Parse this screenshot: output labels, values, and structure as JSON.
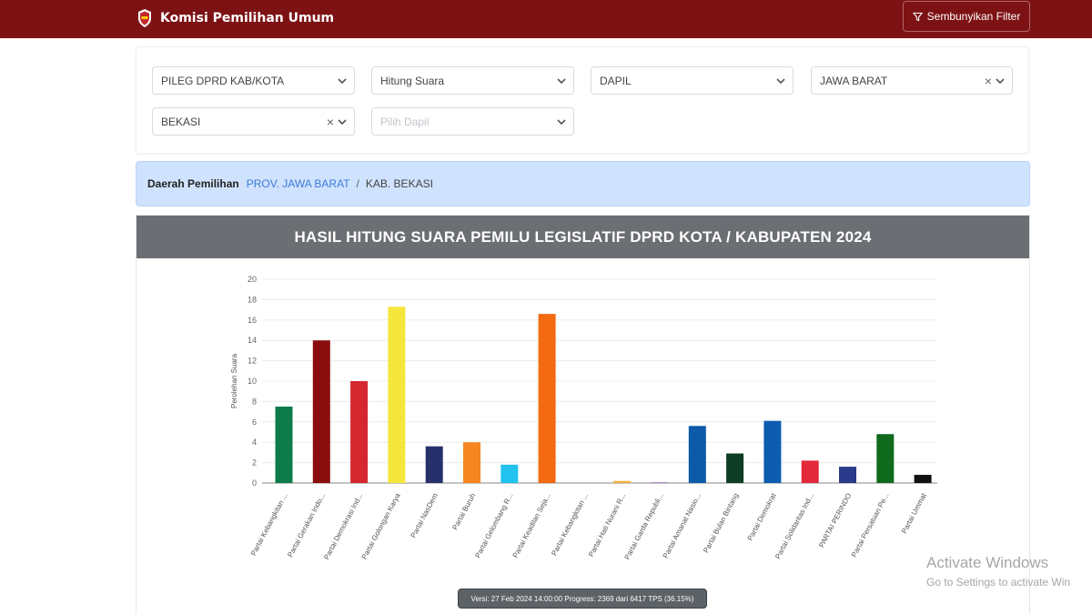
{
  "header": {
    "app_title": "Komisi Pemilihan Umum",
    "filter_button_label": "Sembunyikan Filter",
    "bg_color": "#7d1214"
  },
  "filters": {
    "election_type": "PILEG DPRD KAB/KOTA",
    "count_type": "Hitung Suara",
    "area_level": "DAPIL",
    "province": "JAWA BARAT",
    "regency": "BEKASI",
    "dapil_placeholder": "Pilih Dapil"
  },
  "breadcrumb": {
    "label": "Daerah Pemilihan",
    "province_link": "PROV. JAWA BARAT",
    "separator": "/",
    "current": "KAB. BEKASI"
  },
  "chart_card": {
    "title": "HASIL HITUNG SUARA PEMILU LEGISLATIF DPRD KOTA / KABUPATEN 2024"
  },
  "chart_data": {
    "type": "bar",
    "ylabel": "Perolehan Suara",
    "ylim": [
      0,
      20
    ],
    "yticks": [
      0,
      2,
      4,
      6,
      8,
      10,
      12,
      14,
      16,
      18,
      20
    ],
    "grid": true,
    "categories": [
      "Partai Kebangkitan ...",
      "Partai Gerakan Indo...",
      "Partai Demokrasi Ind...",
      "Partai Golongan Karya",
      "Partai NasDem",
      "Partai Buruh",
      "Partai Gelombang R...",
      "Partai Keadilan Seja...",
      "Partai Kebangkitan ...",
      "Partai Hati Nurani R...",
      "Partai Garda Republi...",
      "Partai Amanat Nasio...",
      "Partai Bulan Bintang",
      "Partai Demokrat",
      "Partai Solidaritas Ind...",
      "PARTAI PERINDO",
      "Partai Persatuan Pe...",
      "Partai Ummat"
    ],
    "values": [
      7.5,
      14,
      10,
      17.3,
      3.6,
      4,
      1.8,
      16.6,
      0,
      0.2,
      0.05,
      5.6,
      2.9,
      6.1,
      2.2,
      1.6,
      4.8,
      0.8
    ],
    "colors": [
      "#0e7c4a",
      "#8b0e0e",
      "#d42730",
      "#f5e63c",
      "#27306b",
      "#f6861f",
      "#22c3ee",
      "#f26a12",
      "#1b7a3b",
      "#f2b036",
      "#6f2f8f",
      "#0c5aa8",
      "#0d3d24",
      "#0d5cb0",
      "#e4283c",
      "#2b3a8a",
      "#0f6a1d",
      "#111111"
    ]
  },
  "status": {
    "tooltip": "Versi: 27 Feb 2024 14:00:00 Progress: 2369 dari 6417 TPS (36.15%)"
  },
  "watermark": {
    "line1": "Activate Windows",
    "line2": "Go to Settings to activate Win"
  }
}
